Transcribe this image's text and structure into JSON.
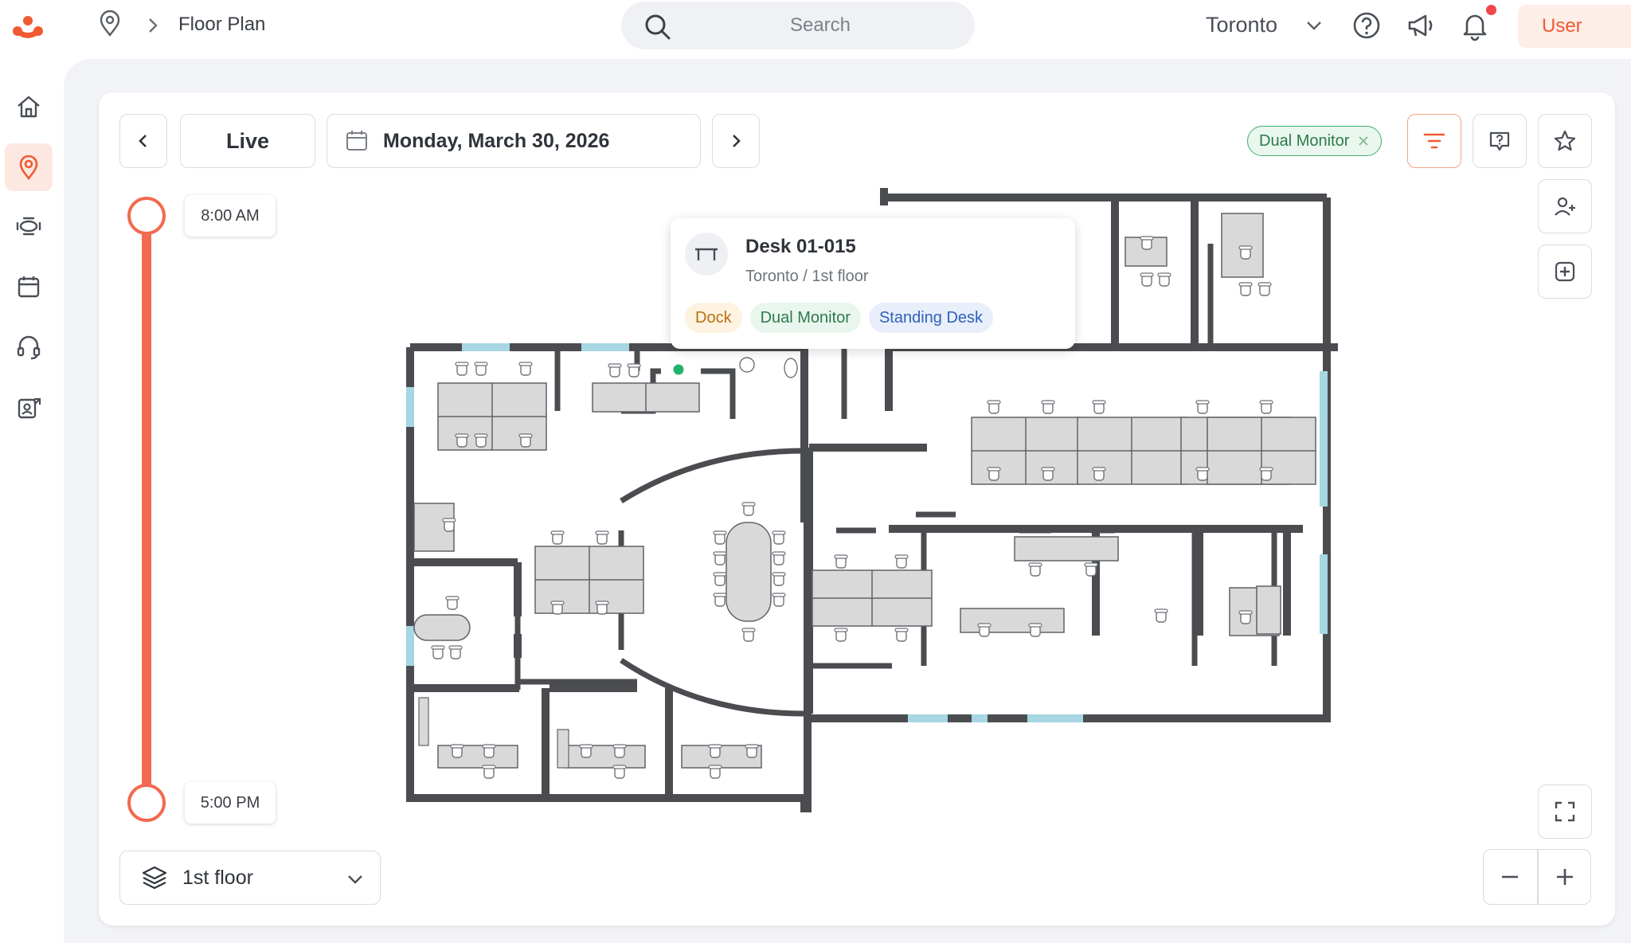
{
  "header": {
    "breadcrumb_title": "Floor Plan",
    "search_placeholder": "Search",
    "location": "Toronto",
    "user_label": "User"
  },
  "sidebar": {
    "items": [
      {
        "icon": "home-icon"
      },
      {
        "icon": "map-pin-icon",
        "active": true
      },
      {
        "icon": "meeting-room-icon"
      },
      {
        "icon": "calendar-icon"
      },
      {
        "icon": "support-headset-icon"
      },
      {
        "icon": "visitor-badge-icon"
      }
    ]
  },
  "toolbar": {
    "live_label": "Live",
    "date": "Monday, March 30, 2026",
    "active_filter": "Dual Monitor"
  },
  "timeline": {
    "start": "8:00 AM",
    "end": "5:00 PM"
  },
  "floor_selector": {
    "selected": "1st floor"
  },
  "popup": {
    "title": "Desk 01-015",
    "subtitle": "Toronto / 1st floor",
    "tags": [
      "Dock",
      "Dual Monitor",
      "Standing Desk"
    ]
  },
  "colors": {
    "accent": "#f26a50",
    "available": "#22b36b"
  }
}
